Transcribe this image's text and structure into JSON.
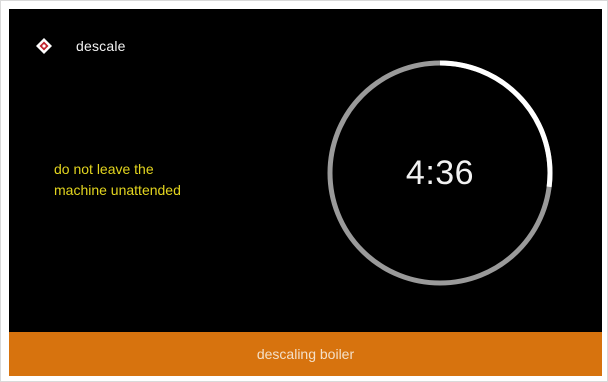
{
  "header": {
    "icon": "descale-diamond-icon",
    "title": "descale"
  },
  "message": {
    "line1": "do not leave the",
    "line2": "machine unattended"
  },
  "timer": {
    "remaining": "4:36",
    "progress_fraction": 0.27,
    "track_color": "#9a9a9a",
    "progress_color": "#ffffff"
  },
  "status": {
    "text": "descaling boiler",
    "color": "#d7730e"
  }
}
